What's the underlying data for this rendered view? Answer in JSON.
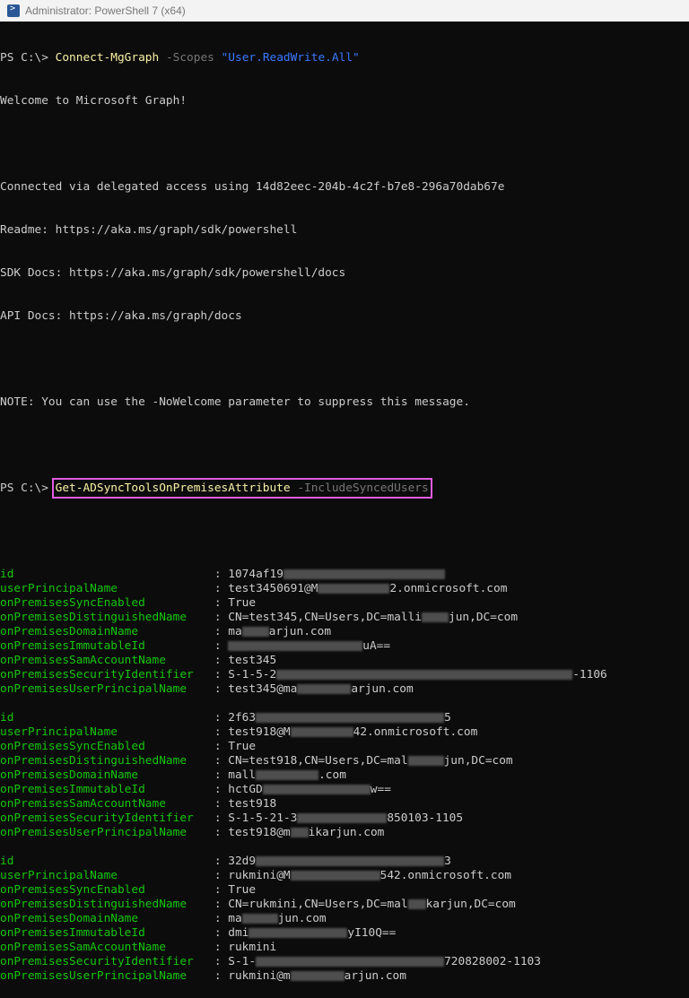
{
  "window": {
    "title": "Administrator: PowerShell 7 (x64)"
  },
  "console": {
    "prompt": "PS C:\\> ",
    "cmd1": {
      "name": "Connect-MgGraph",
      "param": "-Scopes",
      "arg": "\"User.ReadWrite.All\""
    },
    "welcome": "Welcome to Microsoft Graph!",
    "connected": "Connected via delegated access using 14d82eec-204b-4c2f-b7e8-296a70dab67e",
    "readme": "Readme: https://aka.ms/graph/sdk/powershell",
    "sdkdocs": "SDK Docs: https://aka.ms/graph/sdk/powershell/docs",
    "apidocs": "API Docs: https://aka.ms/graph/docs",
    "note": "NOTE: You can use the -NoWelcome parameter to suppress this message.",
    "cmd2": {
      "name": "Get-ADSyncToolsOnPremisesAttribute",
      "param": "-IncludeSyncedUsers"
    },
    "sep": " : ",
    "records": [
      [
        {
          "k": "id                             ",
          "pre": "1074af19",
          "post": ""
        },
        {
          "k": "userPrincipalName              ",
          "pre": "test3450691@M",
          "post": "2.onmicrosoft.com"
        },
        {
          "k": "onPremisesSyncEnabled          ",
          "pre": "True",
          "post": ""
        },
        {
          "k": "onPremisesDistinguishedName    ",
          "pre": "CN=test345,CN=Users,DC=malli",
          "post": "jun,DC=com"
        },
        {
          "k": "onPremisesDomainName           ",
          "pre": "ma",
          "post": "arjun.com"
        },
        {
          "k": "onPremisesImmutableId          ",
          "pre": "",
          "post": "uA=="
        },
        {
          "k": "onPremisesSamAccountName       ",
          "pre": "test345",
          "post": ""
        },
        {
          "k": "onPremisesSecurityIdentifier   ",
          "pre": "S-1-5-2",
          "post": "-1106"
        },
        {
          "k": "onPremisesUserPrincipalName    ",
          "pre": "test345@ma",
          "post": "arjun.com"
        }
      ],
      [
        {
          "k": "id                             ",
          "pre": "2f63",
          "post": "5"
        },
        {
          "k": "userPrincipalName              ",
          "pre": "test918@M",
          "post": "42.onmicrosoft.com"
        },
        {
          "k": "onPremisesSyncEnabled          ",
          "pre": "True",
          "post": ""
        },
        {
          "k": "onPremisesDistinguishedName    ",
          "pre": "CN=test918,CN=Users,DC=mal",
          "post": "jun,DC=com"
        },
        {
          "k": "onPremisesDomainName           ",
          "pre": "mall",
          "post": ".com"
        },
        {
          "k": "onPremisesImmutableId          ",
          "pre": "hctGD",
          "post": "w=="
        },
        {
          "k": "onPremisesSamAccountName       ",
          "pre": "test918",
          "post": ""
        },
        {
          "k": "onPremisesSecurityIdentifier   ",
          "pre": "S-1-5-21-3",
          "post": "850103-1105"
        },
        {
          "k": "onPremisesUserPrincipalName    ",
          "pre": "test918@m",
          "post": "ikarjun.com"
        }
      ],
      [
        {
          "k": "id                             ",
          "pre": "32d9",
          "post": "3"
        },
        {
          "k": "userPrincipalName              ",
          "pre": "rukmini@M",
          "post": "542.onmicrosoft.com"
        },
        {
          "k": "onPremisesSyncEnabled          ",
          "pre": "True",
          "post": ""
        },
        {
          "k": "onPremisesDistinguishedName    ",
          "pre": "CN=rukmini,CN=Users,DC=mal",
          "post": "karjun,DC=com"
        },
        {
          "k": "onPremisesDomainName           ",
          "pre": "ma",
          "post": "jun.com"
        },
        {
          "k": "onPremisesImmutableId          ",
          "pre": "dmi",
          "post": "yI10Q=="
        },
        {
          "k": "onPremisesSamAccountName       ",
          "pre": "rukmini",
          "post": ""
        },
        {
          "k": "onPremisesSecurityIdentifier   ",
          "pre": "S-1-",
          "post": "720828002-1103"
        },
        {
          "k": "onPremisesUserPrincipalName    ",
          "pre": "rukmini@m",
          "post": "arjun.com"
        }
      ]
    ]
  }
}
